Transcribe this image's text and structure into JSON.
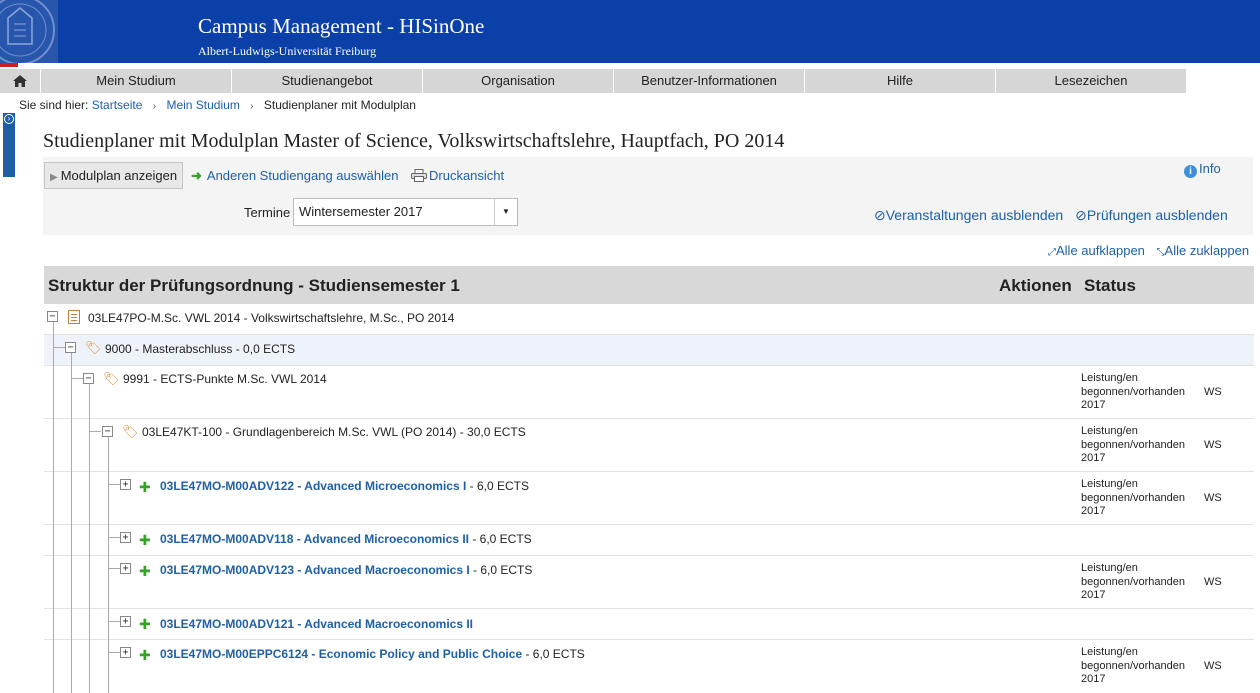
{
  "header": {
    "title": "Campus Management - HISinOne",
    "subtitle": "Albert-Ludwigs-Universität Freiburg"
  },
  "nav": {
    "home_icon": "home-icon",
    "items": [
      {
        "label": "Mein Studium"
      },
      {
        "label": "Studienangebot"
      },
      {
        "label": "Organisation"
      },
      {
        "label": "Benutzer-Informationen"
      },
      {
        "label": "Hilfe"
      },
      {
        "label": "Lesezeichen"
      }
    ]
  },
  "breadcrumb": {
    "prefix": "Sie sind hier:",
    "items": [
      "Startseite",
      "Mein Studium",
      "Studienplaner mit Modulplan"
    ]
  },
  "page_title": "Studienplaner mit Modulplan Master of Science, Volkswirtschaftslehre, Hauptfach, PO 2014",
  "toolbar": {
    "modulplan_button": "Modulplan anzeigen",
    "other_program_link": "Anderen Studiengang auswählen",
    "print_link": "Druckansicht",
    "info_link": "Info",
    "termine_label": "Termine",
    "termine_value": "Wintersemester 2017",
    "hide_courses": "Veranstaltungen ausblenden",
    "hide_exams": "Prüfungen ausblenden",
    "expand_all": "Alle aufklappen",
    "collapse_all": "Alle zuklappen"
  },
  "table": {
    "header_structure": "Struktur der Prüfungsordnung - Studiensemester 1",
    "header_actions": "Aktionen",
    "header_status": "Status",
    "rows": [
      {
        "text": "03LE47PO-M.Sc. VWL 2014 - Volkswirtschaftslehre, M.Sc., PO 2014",
        "suffix": "",
        "status": "",
        "ws": ""
      },
      {
        "text": "9000 - Masterabschluss - 0,0 ECTS",
        "suffix": "",
        "status": "",
        "ws": ""
      },
      {
        "text": "9991 - ECTS-Punkte M.Sc. VWL 2014",
        "suffix": "",
        "status": "Leistung/en\nbegonnen/vorhanden\n2017",
        "ws": "WS"
      },
      {
        "text": "03LE47KT-100 - Grundlagenbereich M.Sc. VWL (PO 2014) - 30,0 ECTS",
        "suffix": "",
        "status": "Leistung/en\nbegonnen/vorhanden\n2017",
        "ws": "WS"
      },
      {
        "text": "03LE47MO-M00ADV122 - Advanced Microeconomics I",
        "suffix": " - 6,0 ECTS",
        "status": "Leistung/en\nbegonnen/vorhanden\n2017",
        "ws": "WS"
      },
      {
        "text": "03LE47MO-M00ADV118 - Advanced Microeconomics II",
        "suffix": " - 6,0 ECTS",
        "status": "",
        "ws": ""
      },
      {
        "text": "03LE47MO-M00ADV123 - Advanced Macroeconomics I",
        "suffix": " - 6,0 ECTS",
        "status": "Leistung/en\nbegonnen/vorhanden\n2017",
        "ws": "WS"
      },
      {
        "text": "03LE47MO-M00ADV121 - Advanced Macroeconomics II",
        "suffix": "",
        "status": "",
        "ws": ""
      },
      {
        "text": "03LE47MO-M00EPPC6124 - Economic Policy and Public Choice",
        "suffix": " - 6,0 ECTS",
        "status": "Leistung/en\nbegonnen/vorhanden\n2017",
        "ws": "WS"
      }
    ]
  },
  "colors": {
    "header_bg": "#0a40a8",
    "link": "#1f5fa6",
    "nav_bg": "#d6d6d6",
    "module_icon": "#3aa02c"
  }
}
